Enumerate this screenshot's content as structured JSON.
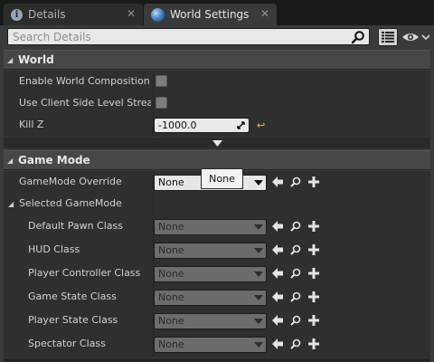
{
  "tabs": [
    {
      "label": "Details",
      "icon": "info-icon",
      "active": false,
      "close": "✕"
    },
    {
      "label": "World Settings",
      "icon": "globe-icon",
      "active": true,
      "close": "✕"
    }
  ],
  "search": {
    "placeholder": "Search Details",
    "value": ""
  },
  "world": {
    "title": "World",
    "props": {
      "enable_world_composition": {
        "label": "Enable World Composition",
        "checked": false
      },
      "use_client_side_level_streaming": {
        "label": "Use Client Side Level Stream",
        "checked": false
      },
      "kill_z": {
        "label": "Kill Z",
        "value": "-1000.0"
      }
    }
  },
  "game_mode": {
    "title": "Game Mode",
    "override": {
      "label": "GameMode Override",
      "value": "None"
    },
    "selected_group": "Selected GameMode",
    "classes": [
      {
        "key": "default_pawn",
        "label": "Default Pawn Class",
        "value": "None"
      },
      {
        "key": "hud",
        "label": "HUD Class",
        "value": "None"
      },
      {
        "key": "player_controller",
        "label": "Player Controller Class",
        "value": "None"
      },
      {
        "key": "game_state",
        "label": "Game State Class",
        "value": "None"
      },
      {
        "key": "player_state",
        "label": "Player State Class",
        "value": "None"
      },
      {
        "key": "spectator",
        "label": "Spectator Class",
        "value": "None"
      }
    ]
  },
  "tooltip": {
    "text": "None"
  },
  "colors": {
    "panel_bg": "#3a3a3a",
    "header_bg": "#474747",
    "row_bg": "#2f2f2f",
    "reset_yellow": "#e6c24b"
  }
}
